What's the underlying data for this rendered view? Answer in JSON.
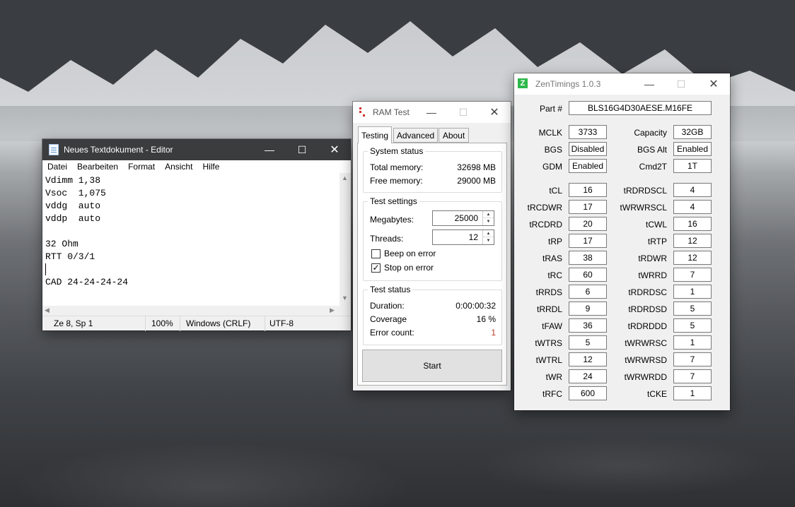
{
  "colors": {
    "editor_titlebar": "#3b3c3e",
    "error_count": "#c0392b",
    "zen_logo": "#2db84b"
  },
  "editor": {
    "title": "Neues Textdokument - Editor",
    "menu": [
      "Datei",
      "Bearbeiten",
      "Format",
      "Ansicht",
      "Hilfe"
    ],
    "text": "Vdimm 1,38\nVsoc  1,075\nvddg  auto\nvddp  auto\n\n32 Ohm\nRTT 0/3/1\n\nCAD 24-24-24-24",
    "status": {
      "position": "Ze 8, Sp 1",
      "zoom": "100%",
      "line_ending": "Windows (CRLF)",
      "encoding": "UTF-8"
    }
  },
  "ramtest": {
    "title": "RAM Test",
    "tabs": [
      "Testing",
      "Advanced",
      "About"
    ],
    "system_status": {
      "title": "System status",
      "total_label": "Total memory:",
      "total_value": "32698 MB",
      "free_label": "Free memory:",
      "free_value": "29000 MB"
    },
    "test_settings": {
      "title": "Test settings",
      "megabytes_label": "Megabytes:",
      "megabytes_value": "25000",
      "threads_label": "Threads:",
      "threads_value": "12",
      "beep_label": "Beep on error",
      "stop_label": "Stop on error"
    },
    "test_status": {
      "title": "Test status",
      "duration_label": "Duration:",
      "duration_value": "0:00:00:32",
      "coverage_label": "Coverage",
      "coverage_value": "16 %",
      "errors_label": "Error count:",
      "errors_value": "1"
    },
    "start_label": "Start"
  },
  "zen": {
    "title": "ZenTimings 1.0.3",
    "logo": "Z",
    "part_label": "Part #",
    "part_value": "BLS16G4D30AESE.M16FE",
    "info": [
      {
        "l1": "MCLK",
        "v1": "3733",
        "l2": "Capacity",
        "v2": "32GB"
      },
      {
        "l1": "BGS",
        "v1": "Disabled",
        "l2": "BGS Alt",
        "v2": "Enabled"
      },
      {
        "l1": "GDM",
        "v1": "Enabled",
        "l2": "Cmd2T",
        "v2": "1T"
      }
    ],
    "timings": [
      {
        "l1": "tCL",
        "v1": "16",
        "l2": "tRDRDSCL",
        "v2": "4"
      },
      {
        "l1": "tRCDWR",
        "v1": "17",
        "l2": "tWRWRSCL",
        "v2": "4"
      },
      {
        "l1": "tRCDRD",
        "v1": "20",
        "l2": "tCWL",
        "v2": "16"
      },
      {
        "l1": "tRP",
        "v1": "17",
        "l2": "tRTP",
        "v2": "12"
      },
      {
        "l1": "tRAS",
        "v1": "38",
        "l2": "tRDWR",
        "v2": "12"
      },
      {
        "l1": "tRC",
        "v1": "60",
        "l2": "tWRRD",
        "v2": "7"
      },
      {
        "l1": "tRRDS",
        "v1": "6",
        "l2": "tRDRDSC",
        "v2": "1"
      },
      {
        "l1": "tRRDL",
        "v1": "9",
        "l2": "tRDRDSD",
        "v2": "5"
      },
      {
        "l1": "tFAW",
        "v1": "36",
        "l2": "tRDRDDD",
        "v2": "5"
      },
      {
        "l1": "tWTRS",
        "v1": "5",
        "l2": "tWRWRSC",
        "v2": "1"
      },
      {
        "l1": "tWTRL",
        "v1": "12",
        "l2": "tWRWRSD",
        "v2": "7"
      },
      {
        "l1": "tWR",
        "v1": "24",
        "l2": "tWRWRDD",
        "v2": "7"
      },
      {
        "l1": "tRFC",
        "v1": "600",
        "l2": "tCKE",
        "v2": "1"
      }
    ]
  }
}
